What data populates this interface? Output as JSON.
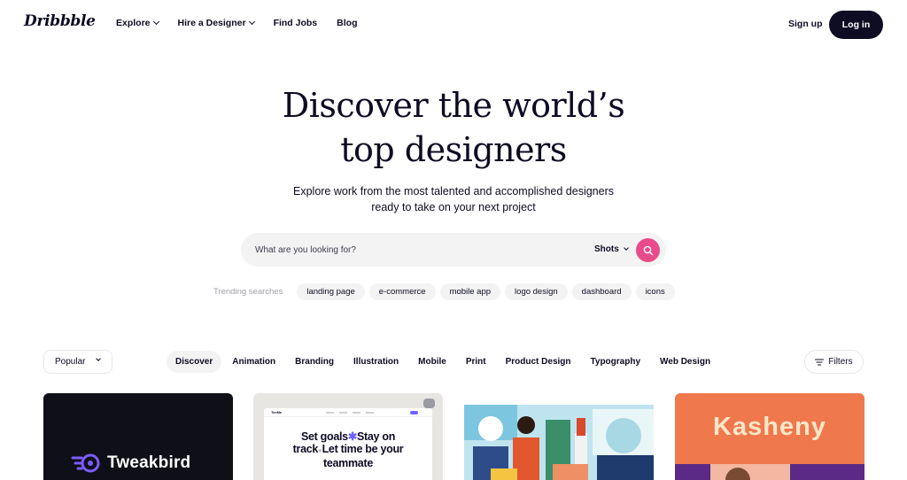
{
  "nav": {
    "logo": "Dribbble",
    "links": [
      {
        "label": "Explore",
        "dropdown": true
      },
      {
        "label": "Hire a Designer",
        "dropdown": true
      },
      {
        "label": "Find Jobs",
        "dropdown": false
      },
      {
        "label": "Blog",
        "dropdown": false
      }
    ],
    "signup": "Sign up",
    "login": "Log in"
  },
  "hero": {
    "title_line1": "Discover the world’s",
    "title_line2": "top designers",
    "subtitle_line1": "Explore work from the most talented and accomplished designers",
    "subtitle_line2": "ready to take on your next project"
  },
  "search": {
    "placeholder": "What are you looking for?",
    "value": "",
    "type_selected": "Shots"
  },
  "trending": {
    "label": "Trending searches",
    "tags": [
      "landing page",
      "e-commerce",
      "mobile app",
      "logo design",
      "dashboard",
      "icons"
    ]
  },
  "filters": {
    "sort_selected": "Popular",
    "categories": [
      "Discover",
      "Animation",
      "Branding",
      "Illustration",
      "Mobile",
      "Print",
      "Product Design",
      "Typography",
      "Web Design"
    ],
    "active_category": "Discover",
    "filters_label": "Filters"
  },
  "shots": [
    {
      "brand_text": "Tweakbird"
    },
    {
      "brand_text": "TeeMe",
      "headline_line1": "Set goals",
      "headline_line1b": "Stay on",
      "headline_line2a": "track",
      "headline_line2b": "Let time be your",
      "headline_line3": "teammate"
    },
    {
      "brand_text": ""
    },
    {
      "brand_text": "Kasheny"
    }
  ],
  "colors": {
    "brand_dark": "#0d0c22",
    "accent_pink": "#ea4c89",
    "chip_bg": "#f3f3f4",
    "muted_text": "#9e9ea7"
  }
}
